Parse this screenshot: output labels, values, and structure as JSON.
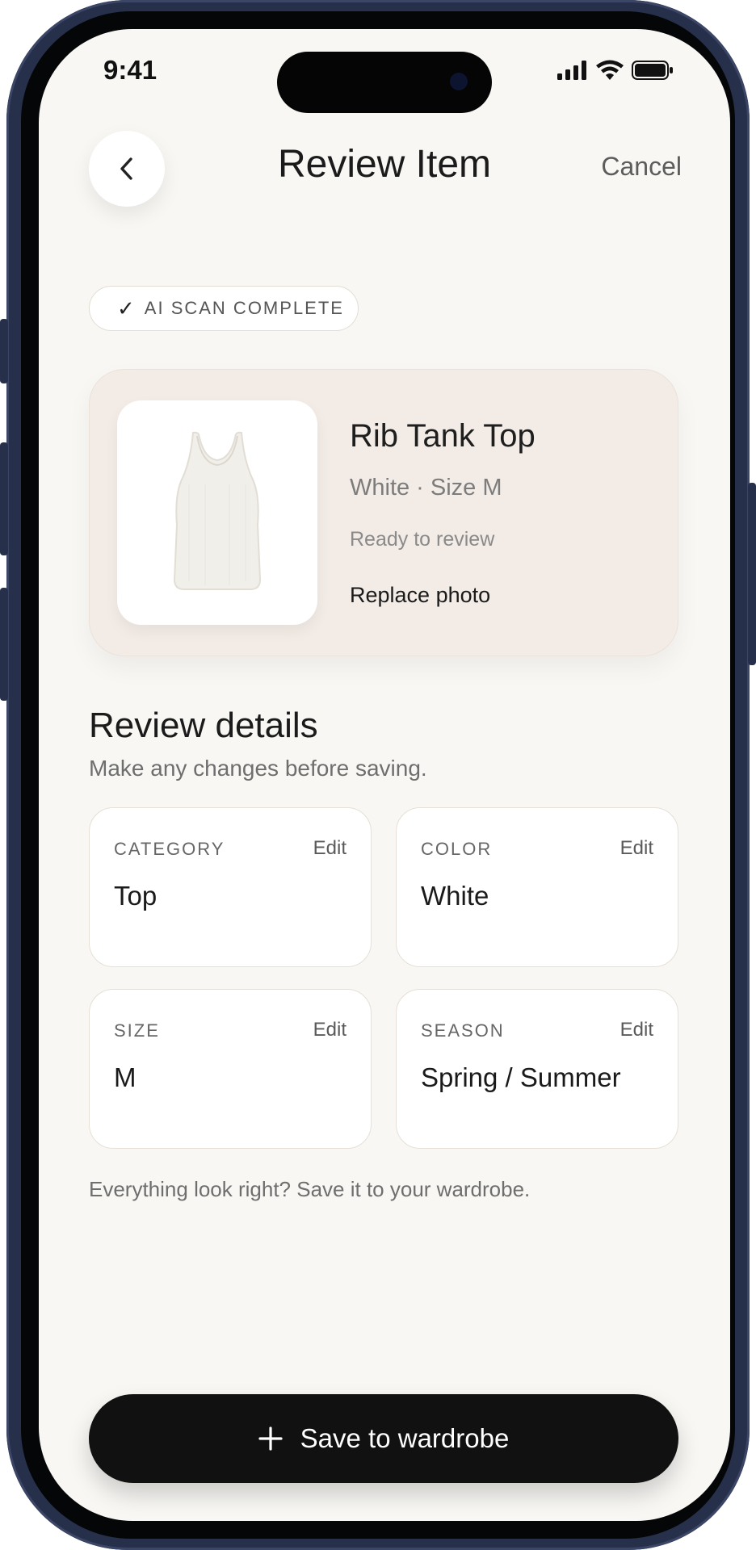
{
  "status_bar": {
    "time": "9:41"
  },
  "header": {
    "title": "Review Item",
    "cancel_label": "Cancel",
    "back_icon": "chevron-left-icon"
  },
  "badge": {
    "check": "✓",
    "label": "AI SCAN COMPLETE"
  },
  "item": {
    "name": "Rib Tank Top",
    "details": "White · Size M",
    "status": "Ready to review",
    "replace_label": "Replace photo"
  },
  "review": {
    "title": "Review details",
    "subtitle": "Make any changes before saving.",
    "fields": [
      {
        "label": "CATEGORY",
        "edit": "Edit",
        "value": "Top"
      },
      {
        "label": "COLOR",
        "edit": "Edit",
        "value": "White"
      },
      {
        "label": "SIZE",
        "edit": "Edit",
        "value": "M"
      },
      {
        "label": "SEASON",
        "edit": "Edit",
        "value": "Spring / Summer"
      }
    ],
    "hint": "Everything look right? Save it to your wardrobe."
  },
  "save_button": {
    "icon": "plus-icon",
    "label": "Save to wardrobe"
  },
  "colors": {
    "background": "#f8f7f4",
    "card": "#f3ece6",
    "primary_button": "#111111",
    "frame": "#27304a"
  }
}
